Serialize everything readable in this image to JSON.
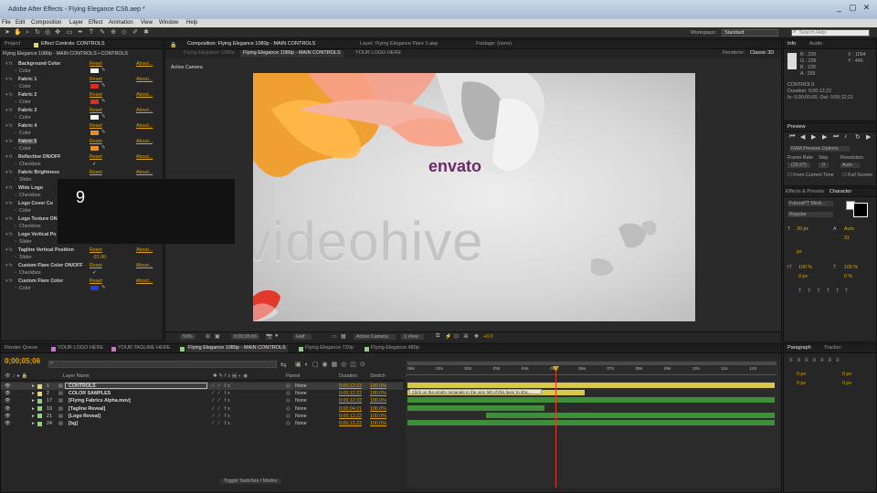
{
  "window": {
    "title": "Adobe After Effects - Flying Elegance CS6.aep *",
    "controls": [
      "_",
      "▢",
      "✕"
    ]
  },
  "menu": [
    "File",
    "Edit",
    "Composition",
    "Layer",
    "Effect",
    "Animation",
    "View",
    "Window",
    "Help"
  ],
  "workspace": {
    "label": "Workspace:",
    "value": "Standard",
    "search_placeholder": "Search Help"
  },
  "project_panel": {
    "tab_project": "Project",
    "tab_effects": "Effect Controls: CONTROLS",
    "breadcrumb": "Flying Elegance 1080p - MAIN CONTROLS • CONTROLS"
  },
  "effects": [
    {
      "name": "Background Color",
      "reset": "Reset",
      "about": "About...",
      "sub": "Color",
      "swatch": "#ffffff"
    },
    {
      "name": "Fabric 1",
      "reset": "Reset",
      "about": "About...",
      "sub": "Color",
      "swatch": "#e02b22"
    },
    {
      "name": "Fabric 2",
      "reset": "Reset",
      "about": "About...",
      "sub": "Color",
      "swatch": "#e02b22"
    },
    {
      "name": "Fabric 3",
      "reset": "Reset",
      "about": "About...",
      "sub": "Color",
      "swatch": "#ffffff"
    },
    {
      "name": "Fabric 4",
      "reset": "Reset",
      "about": "About...",
      "sub": "Color",
      "swatch": "#f28c1e"
    },
    {
      "name": "Fabric 5",
      "reset": "Reset",
      "about": "About...",
      "sub": "Color",
      "swatch": "#f28c1e"
    },
    {
      "name": "Reflective ON/OFF",
      "reset": "Reset",
      "about": "About...",
      "sub": "Checkbox",
      "check": "✓"
    },
    {
      "name": "Fabric Brightness",
      "reset": "Reset",
      "about": "About...",
      "sub": "Slider"
    },
    {
      "name": "Wide Logo",
      "reset": "",
      "about": "",
      "sub": "Checkbox"
    },
    {
      "name": "Logo Cover Co",
      "reset": "",
      "about": "",
      "sub": "Color"
    },
    {
      "name": "Logo Texture ON",
      "reset": "",
      "about": "",
      "sub": "Checkbox"
    },
    {
      "name": "Logo Vertical Po",
      "reset": "",
      "about": "",
      "sub": "Slider"
    },
    {
      "name": "Tagline Vertical Position",
      "reset": "Reset",
      "about": "About...",
      "sub": "Slider",
      "value": "-91.00"
    },
    {
      "name": "Custom Flare Color ON/OFF",
      "reset": "Reset",
      "about": "About...",
      "sub": "Checkbox",
      "check": "✓"
    },
    {
      "name": "Custom Flare Color",
      "reset": "Reset",
      "about": "About...",
      "sub": "Color",
      "swatch": "#1f3ee0"
    }
  ],
  "overlay_number": "9",
  "comp_panel": {
    "tab": "Composition: Flying Elegance 1080p - MAIN CONTROLS",
    "layer_tab": "Layer: Flying Elegance Flare 1.aep",
    "footage_tab": "Footage: (none)",
    "subtabs": [
      "Flying Elegance 1080p",
      "Flying Elegance 1080p - MAIN CONTROLS",
      "YOUR LOGO HERE"
    ],
    "renderer_label": "Renderer:",
    "renderer_value": "Classic 3D",
    "active_camera": "Active Camera",
    "logo_text": "envato",
    "watermark": "videohive",
    "zoom": "50%",
    "timecode": "0;00;05;06",
    "resolution": "Half",
    "view": "Active Camera",
    "views": "1 View",
    "exposure": "+0.0"
  },
  "info_panel": {
    "tab_info": "Info",
    "tab_audio": "Audio",
    "r": "R : 239",
    "g": "G : 239",
    "b": "B : 239",
    "a": "A : 255",
    "x": "X : 1094",
    "y": "Y : 446",
    "layer": "CONTROLS",
    "duration": "Duration: 0;00;12;22",
    "in_out": "In: 0;00;00;00, Out: 0;00;12;21"
  },
  "preview_panel": {
    "tab": "Preview",
    "ram_options": "RAM Preview Options",
    "frame_rate_label": "Frame Rate",
    "frame_rate": "(29.97)",
    "skip_label": "Skip",
    "skip": "0",
    "resolution_label": "Resolution",
    "resolution": "Auto",
    "from_current": "From Current Time",
    "full_screen": "Full Screen"
  },
  "character_panel": {
    "tab_effects": "Effects & Presets",
    "tab_char": "Character",
    "font": "FuturaPT Medi...",
    "style": "Regular",
    "size": "30 px",
    "tracking": "Auto",
    "leading": "31",
    "px": "px",
    "scale_v": "100 %",
    "scale_h": "100 %",
    "baseline": "0 px",
    "tsume": "0 %"
  },
  "timeline": {
    "tabs": [
      "Render Queue",
      "YOUR LOGO HERE",
      "YOUR TAGLINE HERE",
      "Flying Elegance 1080p - MAIN CONTROLS",
      "Flying Elegance 720p",
      "Flying Elegance 480p"
    ],
    "timecode": "0;00;05;06",
    "col_layer": "Layer Name",
    "col_parent": "Parent",
    "col_duration": "Duration",
    "col_stretch": "Stretch",
    "ruler": [
      "00s",
      "01s",
      "02s",
      "03s",
      "04s",
      "05s",
      "06s",
      "07s",
      "08s",
      "09s",
      "10s",
      "11s",
      "12s"
    ],
    "layers": [
      {
        "num": "1",
        "name": "CONTROLS",
        "color": "#e8d85a",
        "parent": "None",
        "duration": "0;00;12;22",
        "stretch": "100.0%"
      },
      {
        "num": "2",
        "name": "COLOR SAMPLES",
        "color": "#e8d85a",
        "parent": "None",
        "duration": "0;00;12;22",
        "stretch": "100.0%"
      },
      {
        "num": "17",
        "name": "[Flying Fabrics Alpha.mov]",
        "color": "#8fd07a",
        "parent": "None",
        "duration": "0;00;12;22",
        "stretch": "100.0%"
      },
      {
        "num": "19",
        "name": "[Tagline Reveal]",
        "color": "#8fd07a",
        "parent": "None",
        "duration": "0;00;04;21",
        "stretch": "100.0%"
      },
      {
        "num": "21",
        "name": "[Logo Reveal]",
        "color": "#8fd07a",
        "parent": "None",
        "duration": "0;00;12;22",
        "stretch": "100.0%"
      },
      {
        "num": "24",
        "name": "[bg]",
        "color": "#8fd07a",
        "parent": "None",
        "duration": "0;00;12;22",
        "stretch": "100.0%"
      }
    ],
    "tooltip": "Click on the empty rectangle in the very left of this layer to sho...",
    "footer": "Toggle Switches / Modes"
  },
  "paragraph_panel": {
    "tab": "Paragraph",
    "tab2": "Tracker",
    "px": "0 px"
  },
  "colors": {
    "accent": "#e0a400",
    "layer_bar_yellow": "#d8c84a",
    "layer_bar_green": "#3f8f3a",
    "cti": "#e03a2a"
  }
}
